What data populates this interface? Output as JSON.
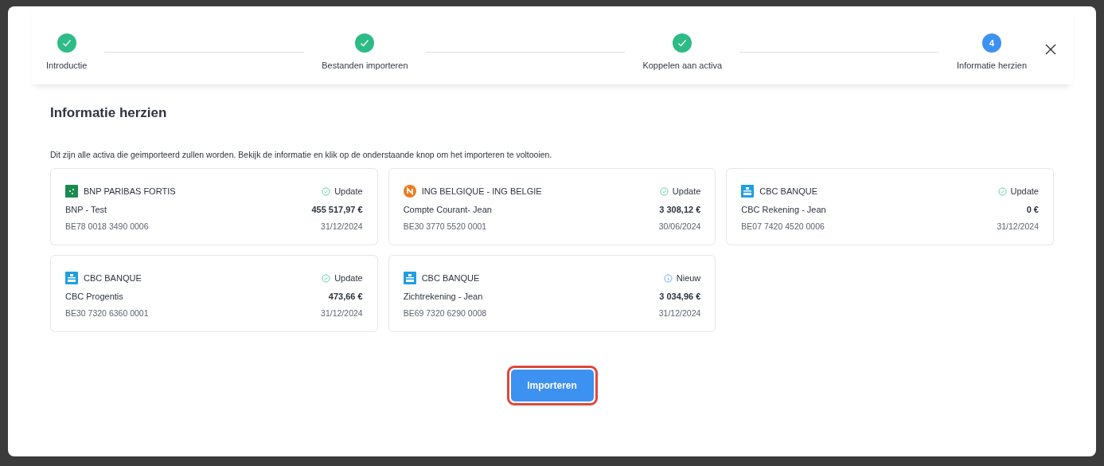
{
  "stepper": {
    "steps": [
      {
        "label": "Introductie",
        "kind": "done"
      },
      {
        "label": "Bestanden importeren",
        "kind": "done"
      },
      {
        "label": "Koppelen aan activa",
        "kind": "done"
      },
      {
        "label": "Informatie herzien",
        "kind": "current",
        "number": "4"
      }
    ]
  },
  "title": "Informatie herzien",
  "description": "Dit zijn alle activa die geimporteerd zullen worden. Bekijk de informatie en klik op de onderstaande knop om het importeren te voltooien.",
  "assets": [
    {
      "bank": {
        "name": "BNP PARIBAS FORTIS",
        "kind": "bnp"
      },
      "status": {
        "label": "Update",
        "kind": "update"
      },
      "name": "BNP - Test",
      "amount": "455 517,97 €",
      "iban": "BE78 0018 3490 0006",
      "date": "31/12/2024"
    },
    {
      "bank": {
        "name": "ING BELGIQUE - ING BELGIE",
        "kind": "ing"
      },
      "status": {
        "label": "Update",
        "kind": "update"
      },
      "name": "Compte Courant- Jean",
      "amount": "3 308,12 €",
      "iban": "BE30 3770 5520 0001",
      "date": "30/06/2024"
    },
    {
      "bank": {
        "name": "CBC BANQUE",
        "kind": "cbc"
      },
      "status": {
        "label": "Update",
        "kind": "update"
      },
      "name": "CBC Rekening - Jean",
      "amount": "0 €",
      "iban": "BE07 7420 4520 0006",
      "date": "31/12/2024"
    },
    {
      "bank": {
        "name": "CBC BANQUE",
        "kind": "cbc"
      },
      "status": {
        "label": "Update",
        "kind": "update"
      },
      "name": "CBC Progentis",
      "amount": "473,66 €",
      "iban": "BE30 7320 6360 0001",
      "date": "31/12/2024"
    },
    {
      "bank": {
        "name": "CBC BANQUE",
        "kind": "cbc"
      },
      "status": {
        "label": "Nieuw",
        "kind": "new"
      },
      "name": "Zichtrekening - Jean",
      "amount": "3 034,96 €",
      "iban": "BE69 7320 6290 0008",
      "date": "31/12/2024"
    }
  ],
  "import_button": {
    "label": "Importeren",
    "highlighted": true
  }
}
